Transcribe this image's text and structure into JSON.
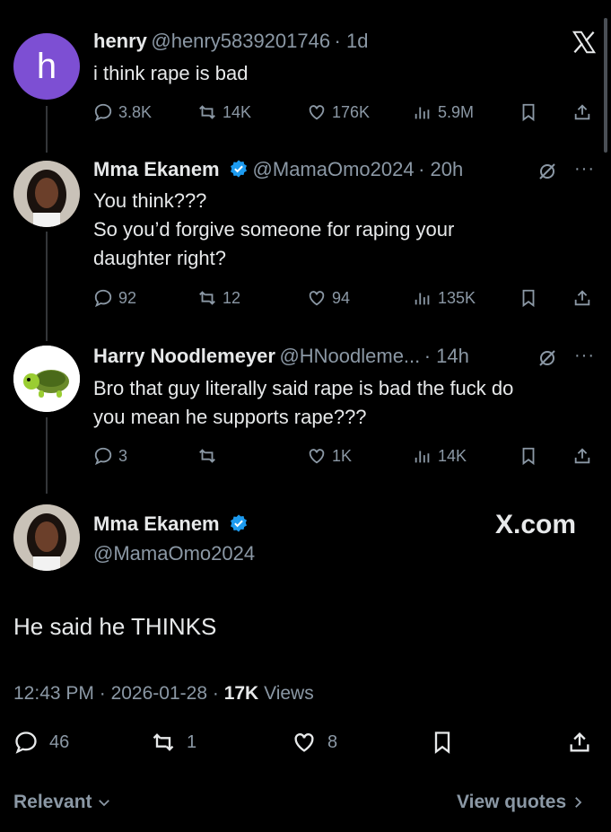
{
  "tweets": [
    {
      "name": "henry",
      "handle": "@henry5839201746",
      "time": "· 1d",
      "avatar_letter": "h",
      "avatar_color": "#7d4fd3",
      "text": [
        "i think rape is bad"
      ],
      "replies": "3.8K",
      "retweets": "14K",
      "likes": "176K",
      "views": "5.9M"
    },
    {
      "name": "Mma Ekanem",
      "handle": "@MamaOmo2024",
      "time": "· 20h",
      "verified": true,
      "text": [
        "You think???",
        "So you’d forgive someone for raping your",
        "daughter right?"
      ],
      "replies": "92",
      "retweets": "12",
      "likes": "94",
      "views": "135K"
    },
    {
      "name": "Harry Noodlemeyer",
      "handle": "@HNoodleme...",
      "time": "· 14h",
      "text": [
        "Bro that guy literally said rape is bad the fuck do",
        "you mean he supports rape???"
      ],
      "replies": "3",
      "retweets": "",
      "likes": "1K",
      "views": "14K"
    }
  ],
  "main": {
    "name": "Mma Ekanem",
    "handle": "@MamaOmo2024",
    "watermark": "X.com",
    "text": "He said he THINKS",
    "time": "12:43 PM",
    "date": "2026-01-28",
    "views_count": "17K",
    "views_label": "Views",
    "replies": "46",
    "retweets": "1",
    "likes": "8"
  },
  "footer": {
    "sort_label": "Relevant",
    "quotes_label": "View quotes"
  },
  "colors": {
    "background": "#000000",
    "text": "#e7e9ea",
    "muted": "#8b98a5",
    "verified": "#1d9bf0"
  },
  "icons": [
    "x-logo-icon",
    "reply-icon",
    "retweet-icon",
    "like-icon",
    "views-icon",
    "bookmark-icon",
    "share-icon",
    "grok-icon",
    "more-icon",
    "verified-icon",
    "chevron-down-icon",
    "chevron-right-icon"
  ]
}
